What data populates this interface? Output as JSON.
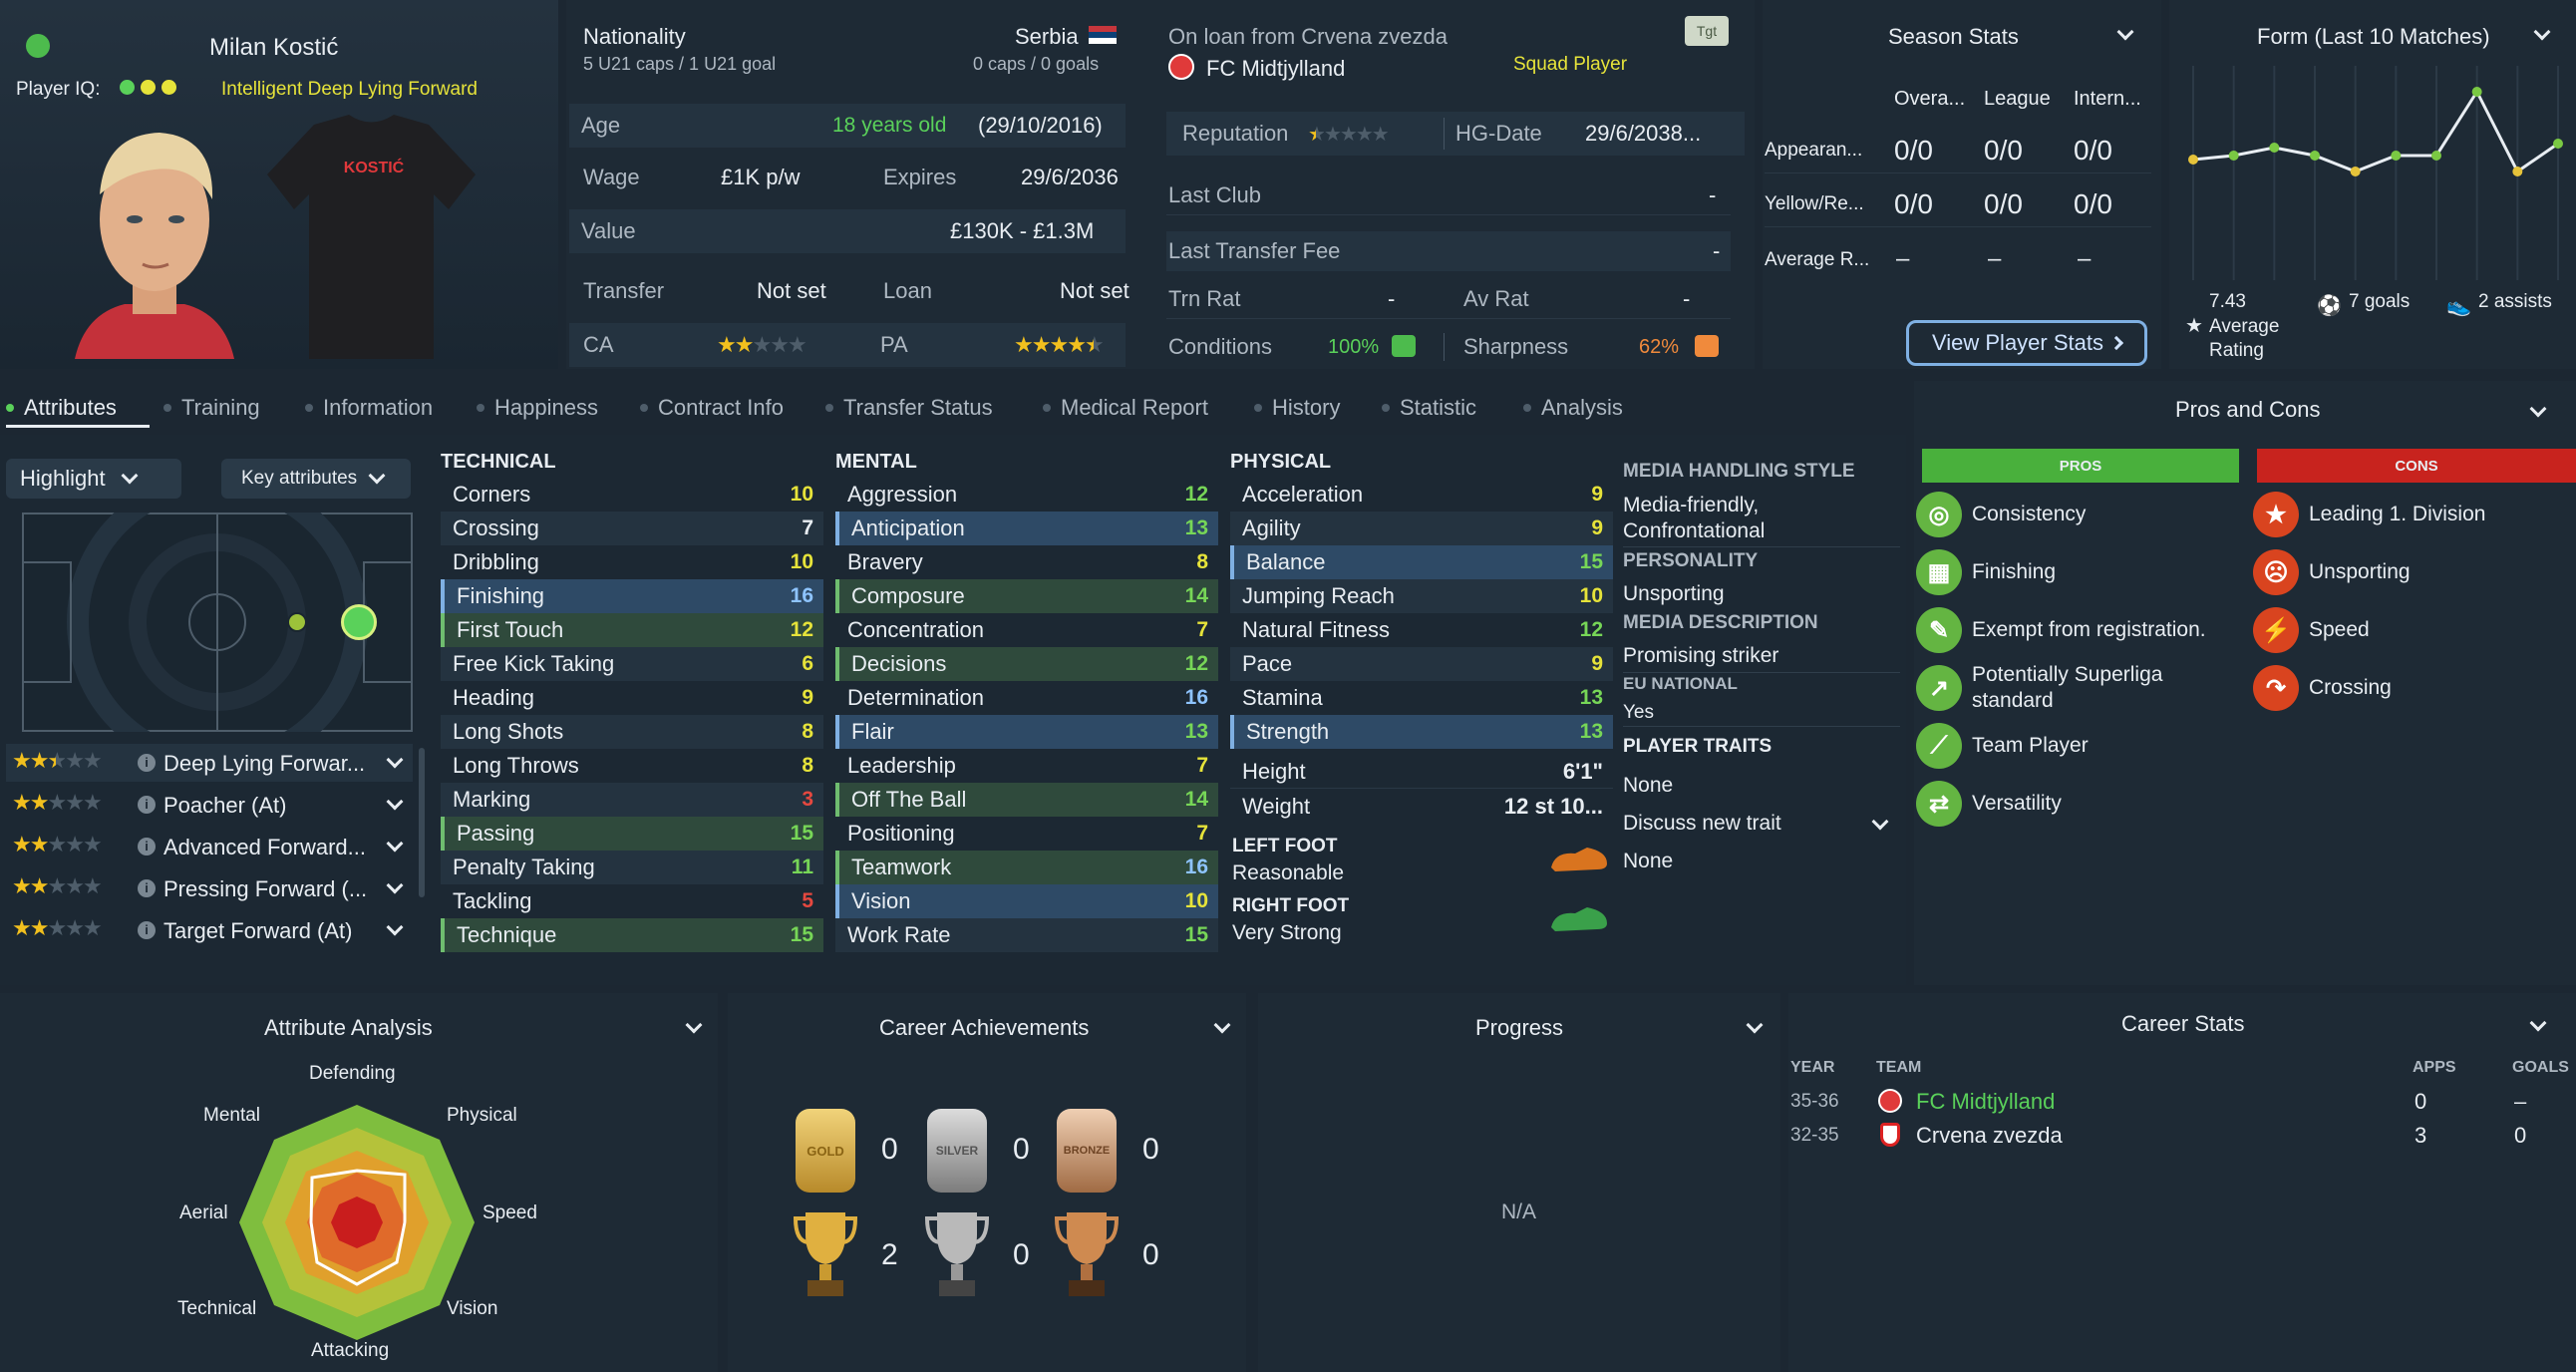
{
  "player": {
    "name": "Milan Kostić",
    "iq_label": "Player IQ:",
    "iq_desc": "Intelligent  Deep Lying Forward",
    "shirt_name": "KOSTIĆ"
  },
  "info": {
    "nationality_label": "Nationality",
    "nationality": "Serbia",
    "u21": "5 U21 caps / 1 U21 goal",
    "caps": "0 caps / 0 goals",
    "age_label": "Age",
    "age": "18 years old",
    "dob": "(29/10/2016)",
    "wage_label": "Wage",
    "wage": "£1K p/w",
    "expires_label": "Expires",
    "expires": "29/6/2036",
    "value_label": "Value",
    "value": "£130K - £1.3M",
    "transfer_label": "Transfer",
    "transfer": "Not set",
    "loan_label": "Loan",
    "loan": "Not set",
    "ca_label": "CA",
    "pa_label": "PA",
    "ca_stars": 2,
    "pa_stars": 4.5
  },
  "club": {
    "loan_from": "On loan from Crvena zvezda",
    "club": "FC Midtjylland",
    "squad": "Squad Player",
    "tgt": "Tgt",
    "reputation_label": "Reputation",
    "reputation_stars": 0.5,
    "hg_label": "HG-Date",
    "hg": "29/6/2038...",
    "last_club_label": "Last Club",
    "last_club": "-",
    "fee_label": "Last Transfer Fee",
    "fee": "-",
    "trn_label": "Trn Rat",
    "trn": "-",
    "av_label": "Av Rat",
    "av": "-",
    "cond_label": "Conditions",
    "cond": "100%",
    "sharp_label": "Sharpness",
    "sharp": "62%"
  },
  "season": {
    "title": "Season Stats",
    "cols": [
      "Overa...",
      "League",
      "Intern..."
    ],
    "rows": [
      {
        "label": "Appearan...",
        "v": [
          "0/0",
          "0/0",
          "0/0"
        ]
      },
      {
        "label": "Yellow/Re...",
        "v": [
          "0/0",
          "0/0",
          "0/0"
        ]
      },
      {
        "label": "Average R...",
        "v": [
          "–",
          "–",
          "–"
        ]
      }
    ],
    "button": "View Player Stats"
  },
  "form": {
    "title": "Form (Last 10 Matches)",
    "avg": "7.43",
    "avg_label": "Average Rating",
    "goals": "7 goals",
    "assists": "2 assists",
    "ratings": [
      6.9,
      7.0,
      7.2,
      7.0,
      6.6,
      7.0,
      7.0,
      8.6,
      6.6,
      7.3
    ]
  },
  "tabs": [
    "Attributes",
    "Training",
    "Information",
    "Happiness",
    "Contract Info",
    "Transfer Status",
    "Medical Report",
    "History",
    "Statistic",
    "Analysis"
  ],
  "controls": {
    "highlight": "Highlight",
    "key": "Key attributes"
  },
  "roles": [
    {
      "name": "Deep Lying Forwar...",
      "stars": 2.5
    },
    {
      "name": "Poacher (At)",
      "stars": 2
    },
    {
      "name": "Advanced Forward...",
      "stars": 2
    },
    {
      "name": "Pressing Forward (...",
      "stars": 2
    },
    {
      "name": "Target Forward (At)",
      "stars": 2
    }
  ],
  "technical": {
    "title": "TECHNICAL",
    "items": [
      {
        "n": "Corners",
        "v": "10",
        "c": "y",
        "h": ""
      },
      {
        "n": "Crossing",
        "v": "7",
        "c": "w",
        "h": ""
      },
      {
        "n": "Dribbling",
        "v": "10",
        "c": "y",
        "h": ""
      },
      {
        "n": "Finishing",
        "v": "16",
        "c": "b",
        "h": "b"
      },
      {
        "n": "First Touch",
        "v": "12",
        "c": "y",
        "h": "g"
      },
      {
        "n": "Free Kick Taking",
        "v": "6",
        "c": "y",
        "h": ""
      },
      {
        "n": "Heading",
        "v": "9",
        "c": "y",
        "h": ""
      },
      {
        "n": "Long Shots",
        "v": "8",
        "c": "y",
        "h": ""
      },
      {
        "n": "Long Throws",
        "v": "8",
        "c": "y",
        "h": ""
      },
      {
        "n": "Marking",
        "v": "3",
        "c": "r",
        "h": ""
      },
      {
        "n": "Passing",
        "v": "15",
        "c": "g",
        "h": "g"
      },
      {
        "n": "Penalty Taking",
        "v": "11",
        "c": "g",
        "h": ""
      },
      {
        "n": "Tackling",
        "v": "5",
        "c": "r",
        "h": ""
      },
      {
        "n": "Technique",
        "v": "15",
        "c": "g",
        "h": "g"
      }
    ]
  },
  "mental": {
    "title": "MENTAL",
    "items": [
      {
        "n": "Aggression",
        "v": "12",
        "c": "g",
        "h": ""
      },
      {
        "n": "Anticipation",
        "v": "13",
        "c": "g",
        "h": "b"
      },
      {
        "n": "Bravery",
        "v": "8",
        "c": "y",
        "h": ""
      },
      {
        "n": "Composure",
        "v": "14",
        "c": "g",
        "h": "g"
      },
      {
        "n": "Concentration",
        "v": "7",
        "c": "y",
        "h": ""
      },
      {
        "n": "Decisions",
        "v": "12",
        "c": "g",
        "h": "g"
      },
      {
        "n": "Determination",
        "v": "16",
        "c": "b",
        "h": ""
      },
      {
        "n": "Flair",
        "v": "13",
        "c": "g",
        "h": "b"
      },
      {
        "n": "Leadership",
        "v": "7",
        "c": "y",
        "h": ""
      },
      {
        "n": "Off The Ball",
        "v": "14",
        "c": "g",
        "h": "g"
      },
      {
        "n": "Positioning",
        "v": "7",
        "c": "y",
        "h": ""
      },
      {
        "n": "Teamwork",
        "v": "16",
        "c": "b",
        "h": "g"
      },
      {
        "n": "Vision",
        "v": "10",
        "c": "y",
        "h": "b"
      },
      {
        "n": "Work Rate",
        "v": "15",
        "c": "g",
        "h": ""
      }
    ]
  },
  "physical": {
    "title": "PHYSICAL",
    "items": [
      {
        "n": "Acceleration",
        "v": "9",
        "c": "y",
        "h": ""
      },
      {
        "n": "Agility",
        "v": "9",
        "c": "y",
        "h": ""
      },
      {
        "n": "Balance",
        "v": "15",
        "c": "g",
        "h": "b"
      },
      {
        "n": "Jumping Reach",
        "v": "10",
        "c": "y",
        "h": ""
      },
      {
        "n": "Natural Fitness",
        "v": "12",
        "c": "g",
        "h": ""
      },
      {
        "n": "Pace",
        "v": "9",
        "c": "y",
        "h": ""
      },
      {
        "n": "Stamina",
        "v": "13",
        "c": "g",
        "h": ""
      },
      {
        "n": "Strength",
        "v": "13",
        "c": "g",
        "h": "b"
      }
    ],
    "height_label": "Height",
    "height": "6'1\"",
    "weight_label": "Weight",
    "weight": "12 st 10...",
    "left_foot_label": "LEFT FOOT",
    "left_foot": "Reasonable",
    "right_foot_label": "RIGHT FOOT",
    "right_foot": "Very Strong"
  },
  "media": {
    "style_label": "MEDIA HANDLING STYLE",
    "style": "Media-friendly, Confrontational",
    "personality_label": "PERSONALITY",
    "personality": "Unsporting",
    "desc_label": "MEDIA DESCRIPTION",
    "desc": "Promising striker",
    "eu_label": "EU NATIONAL",
    "eu": "Yes",
    "traits_label": "PLAYER TRAITS",
    "traits": "None",
    "discuss": "Discuss new trait",
    "discuss_value": "None"
  },
  "pros_cons": {
    "title": "Pros and Cons",
    "pros_label": "PROS",
    "cons_label": "CONS",
    "pros": [
      "Consistency",
      "Finishing",
      "Exempt from registration.",
      "Potentially Superliga standard",
      "Team Player",
      "Versatility"
    ],
    "cons": [
      "Leading 1. Division",
      "Unsporting",
      "Speed",
      "Crossing"
    ]
  },
  "analysis": {
    "title": "Attribute Analysis",
    "labels": [
      "Defending",
      "Physical",
      "Speed",
      "Vision",
      "Attacking",
      "Technical",
      "Aerial",
      "Mental"
    ]
  },
  "achievements": {
    "title": "Career Achievements",
    "medals": [
      "GOLD",
      "SILVER",
      "BRONZE"
    ],
    "medal_counts": [
      "0",
      "0",
      "0"
    ],
    "trophy_counts": [
      "2",
      "0",
      "0"
    ]
  },
  "progress": {
    "title": "Progress",
    "na": "N/A"
  },
  "career": {
    "title": "Career Stats",
    "cols": [
      "YEAR",
      "TEAM",
      "APPS",
      "GOALS"
    ],
    "rows": [
      {
        "year": "35-36",
        "team": "FC Midtjylland",
        "apps": "0",
        "goals": "–"
      },
      {
        "year": "32-35",
        "team": "Crvena zvezda",
        "apps": "3",
        "goals": "0"
      }
    ]
  },
  "colors": {
    "yellow": "#e6e33a",
    "green": "#5ad15a",
    "blue": "#8ec4ff",
    "red": "#e5483f",
    "panel": "#1e2a35"
  }
}
